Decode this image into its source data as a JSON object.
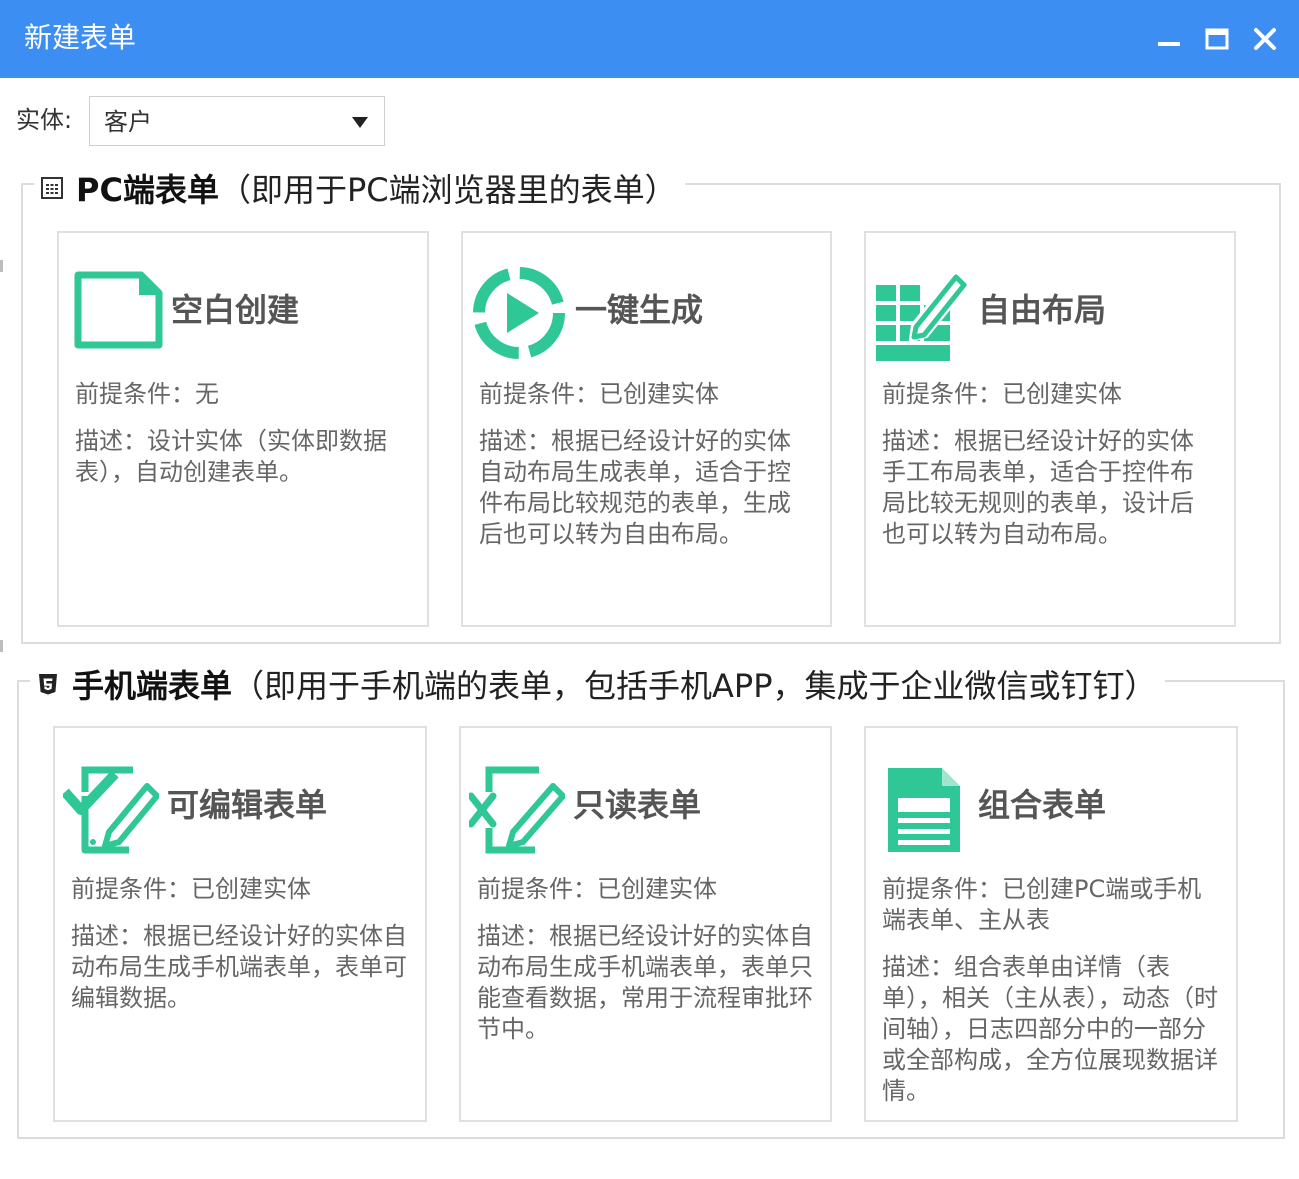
{
  "window": {
    "title": "新建表单",
    "titlebar_color": "#3d8ef2",
    "controls": [
      "minimize-icon",
      "maximize-icon",
      "close-icon"
    ]
  },
  "entity": {
    "label": "实体:",
    "selected": "客户"
  },
  "accent_color": "#2ec795",
  "pc_group": {
    "title": "PC端表单",
    "subtitle": "（即用于PC端浏览器里的表单）",
    "icon": "form-grid-icon",
    "cards": [
      {
        "icon": "blank-page-icon",
        "title": "空白创建",
        "prerequisite": "前提条件：无",
        "description": "描述：设计实体（实体即数据表），自动创建表单。"
      },
      {
        "icon": "play-circle-icon",
        "title": "一键生成",
        "prerequisite": "前提条件：已创建实体",
        "description": "描述：根据已经设计好的实体自动布局生成表单，适合于控件布局比较规范的表单，生成后也可以转为自由布局。"
      },
      {
        "icon": "grid-edit-icon",
        "title": "自由布局",
        "prerequisite": "前提条件：已创建实体",
        "description": "描述：根据已经设计好的实体手工布局表单，适合于控件布局比较无规则的表单，设计后也可以转为自动布局。"
      }
    ]
  },
  "mobile_group": {
    "title": "手机端表单",
    "subtitle": "（即用于手机端的表单，包括手机APP，集成于企业微信或钉钉）",
    "icon": "html5-icon",
    "cards": [
      {
        "icon": "check-edit-icon",
        "title": "可编辑表单",
        "prerequisite": "前提条件：已创建实体",
        "description": "描述：根据已经设计好的实体自动布局生成手机端表单，表单可编辑数据。"
      },
      {
        "icon": "x-edit-icon",
        "title": "只读表单",
        "prerequisite": "前提条件：已创建实体",
        "description": "描述：根据已经设计好的实体自动布局生成手机端表单，表单只能查看数据，常用于流程审批环节中。"
      },
      {
        "icon": "document-icon",
        "title": "组合表单",
        "prerequisite": "前提条件：已创建PC端或手机端表单、主从表",
        "description": "描述：组合表单由详情（表单），相关（主从表），动态（时间轴），日志四部分中的一部分或全部构成，全方位展现数据详情。"
      }
    ]
  }
}
